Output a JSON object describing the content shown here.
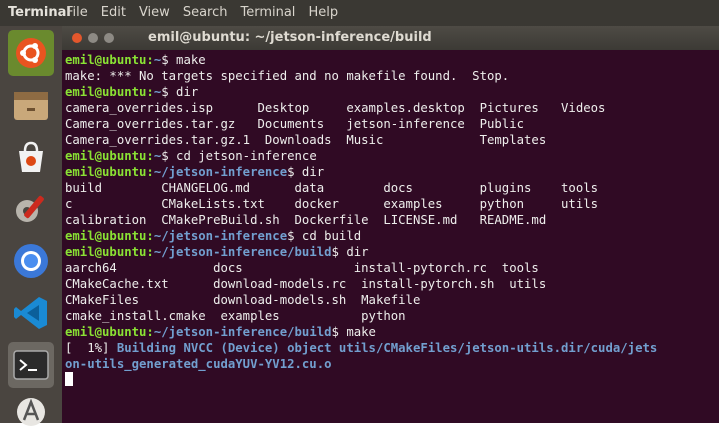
{
  "top_bar": {
    "app_name": "Terminal",
    "menu": [
      "File",
      "Edit",
      "View",
      "Search",
      "Terminal",
      "Help"
    ]
  },
  "launcher": {
    "items": [
      "ubuntu-logo-icon",
      "files-icon",
      "software-center-icon",
      "settings-tools-icon",
      "chromium-icon",
      "vscode-icon",
      "terminal-icon",
      "updater-icon"
    ]
  },
  "window": {
    "title": "emil@ubuntu: ~/jetson-inference/build"
  },
  "colors": {
    "terminal_bg": "#300a24",
    "prompt_user": "#8ae234",
    "prompt_path": "#729fcf",
    "text": "#eeeeec"
  },
  "terminal": {
    "lines": [
      [
        {
          "t": "emil@ubuntu:",
          "c": "user"
        },
        {
          "t": "~",
          "c": "path"
        },
        {
          "t": "$ make",
          "c": ""
        }
      ],
      [
        {
          "t": "make: *** No targets specified and no makefile found.  Stop.",
          "c": ""
        }
      ],
      [
        {
          "t": "emil@ubuntu:",
          "c": "user"
        },
        {
          "t": "~",
          "c": "path"
        },
        {
          "t": "$ dir",
          "c": ""
        }
      ],
      [
        {
          "t": "camera_overrides.isp      Desktop     examples.desktop  Pictures   Videos",
          "c": ""
        }
      ],
      [
        {
          "t": "Camera_overrides.tar.gz   Documents   jetson-inference  Public",
          "c": ""
        }
      ],
      [
        {
          "t": "Camera_overrides.tar.gz.1  Downloads  Music             Templates",
          "c": ""
        }
      ],
      [
        {
          "t": "emil@ubuntu:",
          "c": "user"
        },
        {
          "t": "~",
          "c": "path"
        },
        {
          "t": "$ cd jetson-inference",
          "c": ""
        }
      ],
      [
        {
          "t": "emil@ubuntu:",
          "c": "user"
        },
        {
          "t": "~/jetson-inference",
          "c": "path"
        },
        {
          "t": "$ dir",
          "c": ""
        }
      ],
      [
        {
          "t": "build        CHANGELOG.md      data        docs         plugins    tools",
          "c": ""
        }
      ],
      [
        {
          "t": "c            CMakeLists.txt    docker      examples     python     utils",
          "c": ""
        }
      ],
      [
        {
          "t": "calibration  CMakePreBuild.sh  Dockerfile  LICENSE.md   README.md",
          "c": ""
        }
      ],
      [
        {
          "t": "emil@ubuntu:",
          "c": "user"
        },
        {
          "t": "~/jetson-inference",
          "c": "path"
        },
        {
          "t": "$ cd build",
          "c": ""
        }
      ],
      [
        {
          "t": "emil@ubuntu:",
          "c": "user"
        },
        {
          "t": "~/jetson-inference/build",
          "c": "path"
        },
        {
          "t": "$ dir",
          "c": ""
        }
      ],
      [
        {
          "t": "aarch64             docs               install-pytorch.rc  tools",
          "c": ""
        }
      ],
      [
        {
          "t": "CMakeCache.txt      download-models.rc  install-pytorch.sh  utils",
          "c": ""
        }
      ],
      [
        {
          "t": "CMakeFiles          download-models.sh  Makefile",
          "c": ""
        }
      ],
      [
        {
          "t": "cmake_install.cmake  examples           python",
          "c": ""
        }
      ],
      [
        {
          "t": "emil@ubuntu:",
          "c": "user"
        },
        {
          "t": "~/jetson-inference/build",
          "c": "path"
        },
        {
          "t": "$ make",
          "c": ""
        }
      ],
      [
        {
          "t": "[  1%] ",
          "c": ""
        },
        {
          "t": "Building NVCC (Device) object utils/CMakeFiles/jetson-utils.dir/cuda/jets",
          "c": "blue"
        }
      ],
      [
        {
          "t": "on-utils_generated_cudaYUV-YV12.cu.o",
          "c": "blue"
        }
      ]
    ]
  }
}
